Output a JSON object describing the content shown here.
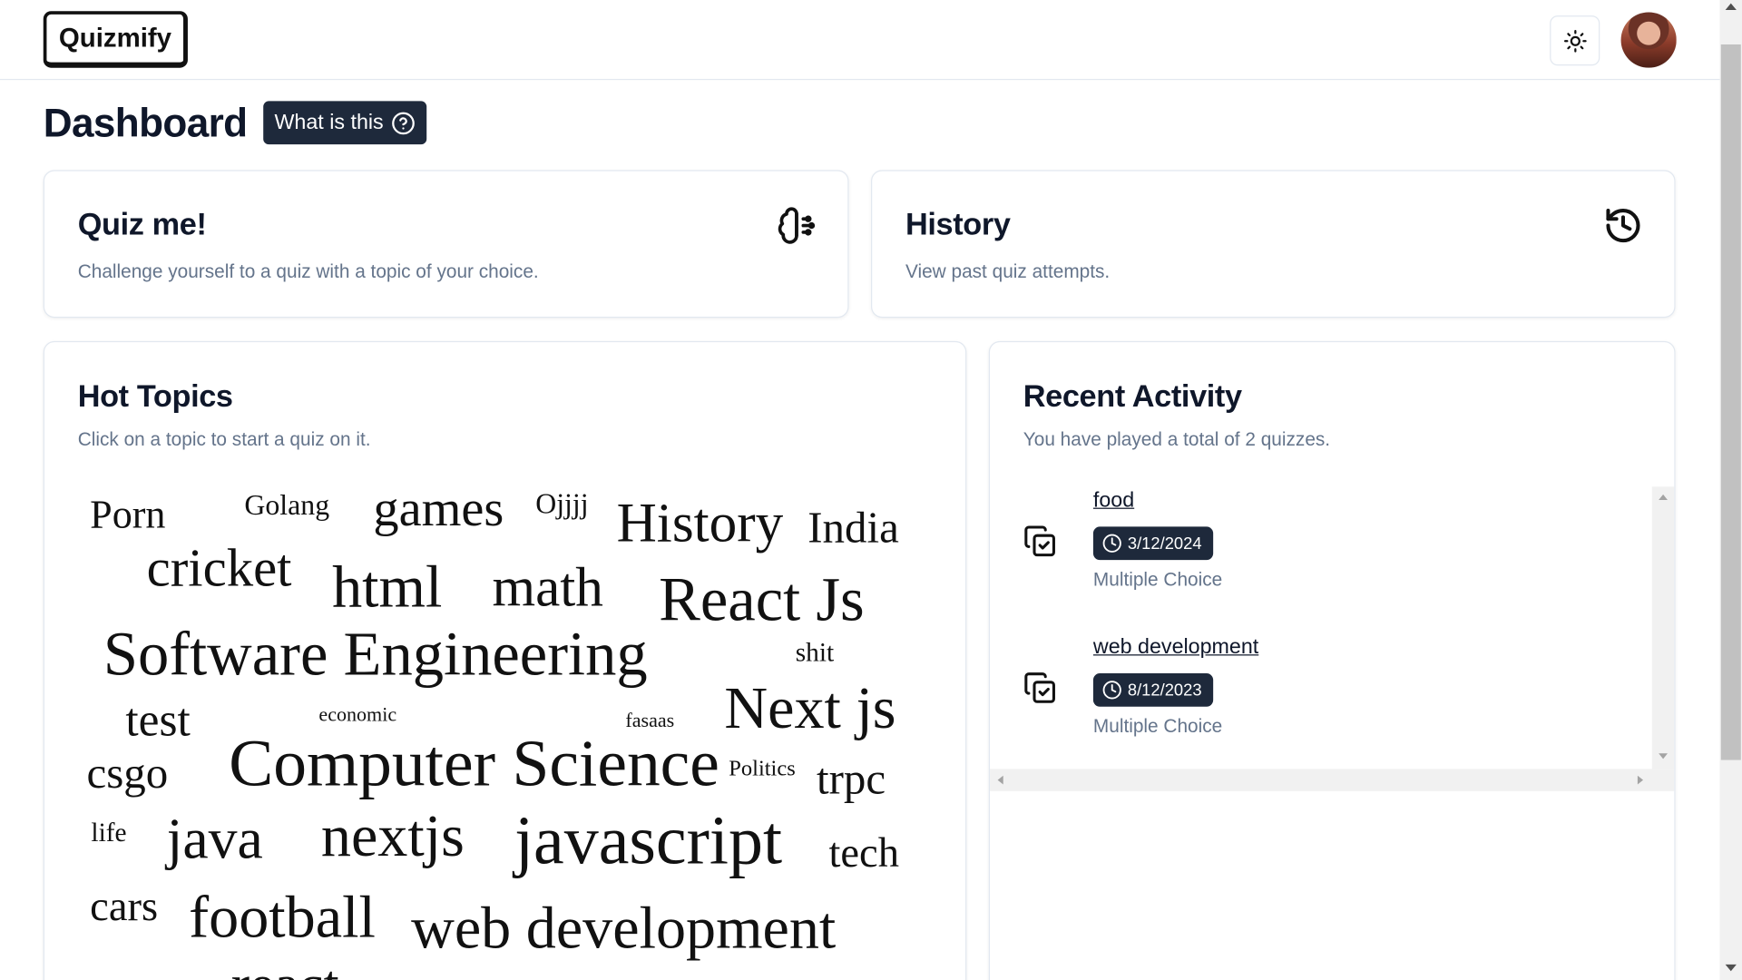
{
  "header": {
    "logo": "Quizmify",
    "theme_icon": "sun-icon",
    "avatar_icon": "user-avatar"
  },
  "page": {
    "title": "Dashboard",
    "help_button": "What is this",
    "help_icon": "question-circle-icon"
  },
  "quiz_card": {
    "title": "Quiz me!",
    "description": "Challenge yourself to a quiz with a topic of your choice.",
    "icon": "brain-circuit-icon"
  },
  "history_card": {
    "title": "History",
    "description": "View past quiz attempts.",
    "icon": "history-icon"
  },
  "hot_topics": {
    "title": "Hot Topics",
    "description": "Click on a topic to start a quiz on it.",
    "words": [
      "Porn",
      "Golang",
      "games",
      "Ojjjj",
      "History",
      "India",
      "cricket",
      "html",
      "math",
      "React Js",
      "Software Engineering",
      "shit",
      "test",
      "economic",
      "fasaas",
      "Next js",
      "csgo",
      "Computer Science",
      "Politics",
      "trpc",
      "life",
      "java",
      "nextjs",
      "javascript",
      "tech",
      "cars",
      "football",
      "web development",
      "react"
    ]
  },
  "recent_activity": {
    "title": "Recent Activity",
    "description": "You have played a total of 2 quizzes.",
    "items": [
      {
        "topic": "food",
        "date": "3/12/2024",
        "type": "Multiple Choice",
        "icon": "copy-check-icon"
      },
      {
        "topic": "web development",
        "date": "8/12/2023",
        "type": "Multiple Choice",
        "icon": "copy-check-icon"
      }
    ]
  },
  "colors": {
    "dark_badge": "#1e293b",
    "muted_text": "#64748b",
    "border": "#e2e8f0"
  }
}
